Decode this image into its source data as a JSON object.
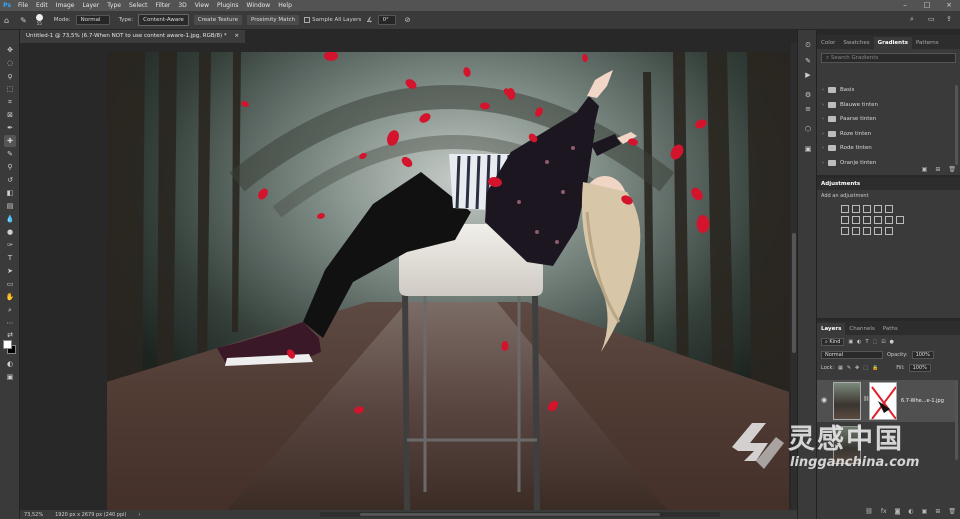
{
  "menubar": {
    "logo": "Ps",
    "items": [
      "File",
      "Edit",
      "Image",
      "Layer",
      "Type",
      "Select",
      "Filter",
      "3D",
      "View",
      "Plugins",
      "Window",
      "Help"
    ]
  },
  "options": {
    "brush_size": "55",
    "mode_label": "Mode:",
    "mode_value": "Normal",
    "type_label": "Type:",
    "type_buttons": [
      "Content-Aware",
      "Create Texture",
      "Proximity Match"
    ],
    "sample_all_layers": "Sample All Layers",
    "angle_value": "0°"
  },
  "document": {
    "tab_title": "Untitled-1 @ 73,5% (6.7-When NOT to use content aware-1.jpg, RGB/8) *",
    "close_glyph": "×"
  },
  "status": {
    "zoom": "73,52%",
    "doc_size": "1920 px x 2679 px (240 ppi)"
  },
  "gradients_panel": {
    "tabs": [
      "Color",
      "Swatches",
      "Gradients",
      "Patterns"
    ],
    "search_placeholder": "Search Gradients",
    "folders": [
      "Basis",
      "Blauwe tinten",
      "Paarse tinten",
      "Roze tinten",
      "Rode tinten",
      "Oranje tinten"
    ]
  },
  "adjustments_panel": {
    "title": "Adjustments",
    "subtitle": "Add an adjustment"
  },
  "layers_panel": {
    "tabs": [
      "Layers",
      "Channels",
      "Paths"
    ],
    "kind_label": "Kind",
    "blend_mode": "Normal",
    "opacity_label": "Opacity:",
    "opacity_value": "100%",
    "lock_label": "Lock:",
    "fill_label": "Fill:",
    "fill_value": "100%",
    "layer_name": "6.7-Whe...e-1.jpg"
  },
  "watermark": {
    "cn_text": "灵感中国",
    "url": "lingganchina.com"
  },
  "colors": {
    "accent": "#31a8ff",
    "petal": "#d4142c",
    "panel_bg": "#3a3a3a",
    "menu_bg": "#535353"
  }
}
